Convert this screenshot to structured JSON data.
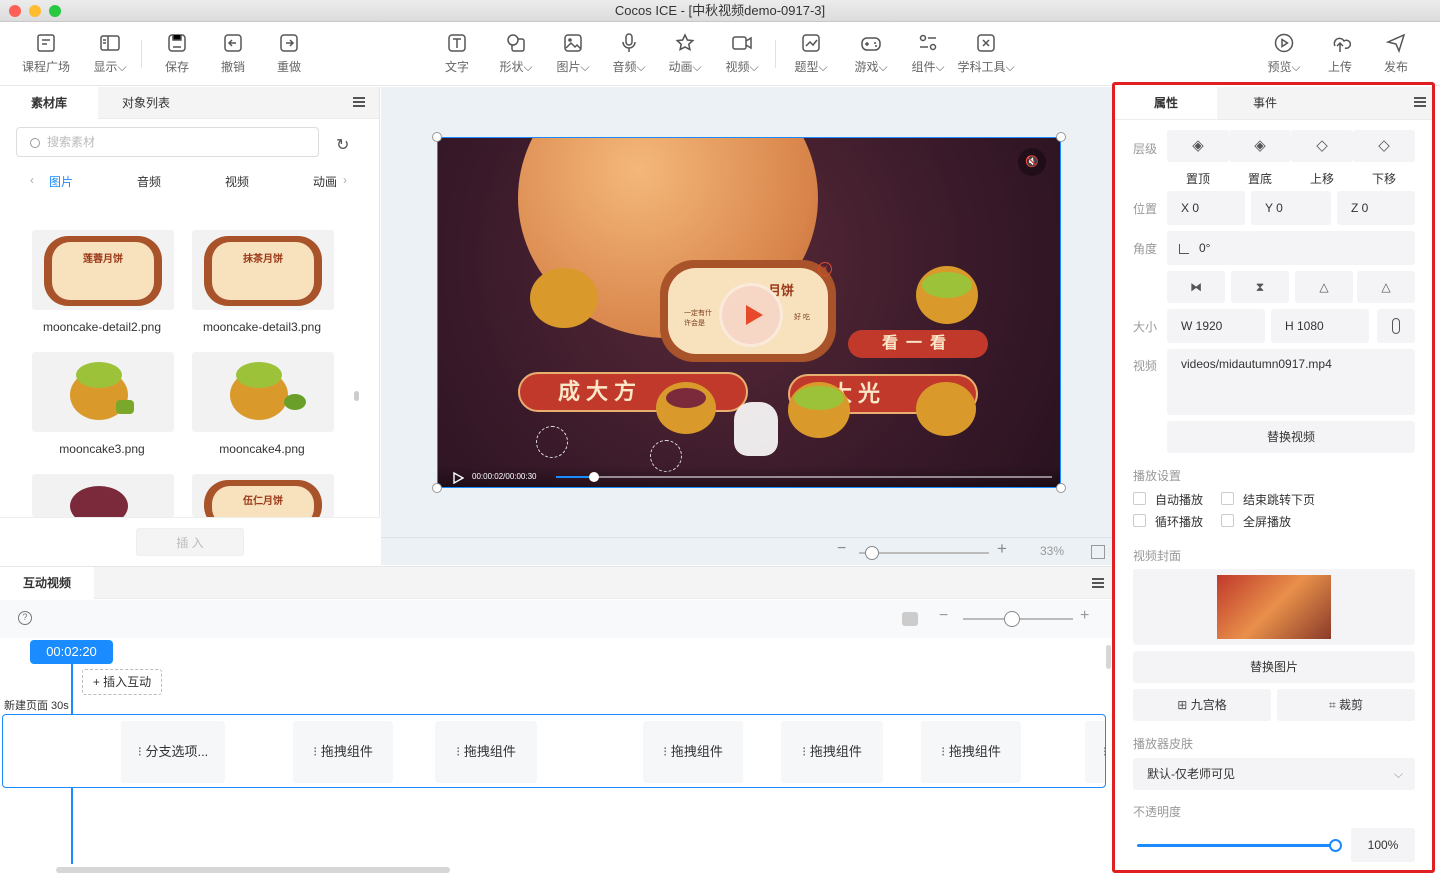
{
  "window": {
    "title": "Cocos ICE - [中秋视频demo-0917-3]"
  },
  "toolbar": {
    "left": [
      {
        "label": "课程广场",
        "icon": "course-square-icon"
      },
      {
        "label": "显示",
        "icon": "display-icon"
      },
      {
        "label": "保存",
        "icon": "save-icon"
      },
      {
        "label": "撤销",
        "icon": "undo-icon"
      },
      {
        "label": "重做",
        "icon": "redo-icon"
      }
    ],
    "center": [
      {
        "label": "文字",
        "icon": "text-icon"
      },
      {
        "label": "形状",
        "icon": "shape-icon"
      },
      {
        "label": "图片",
        "icon": "image-icon"
      },
      {
        "label": "音频",
        "icon": "audio-icon"
      },
      {
        "label": "动画",
        "icon": "animation-icon"
      },
      {
        "label": "视频",
        "icon": "video-icon"
      },
      {
        "label": "题型",
        "icon": "question-type-icon"
      },
      {
        "label": "游戏",
        "icon": "game-icon"
      },
      {
        "label": "组件",
        "icon": "component-icon"
      },
      {
        "label": "学科工具",
        "icon": "subject-tools-icon"
      }
    ],
    "right": [
      {
        "label": "预览",
        "icon": "preview-icon"
      },
      {
        "label": "上传",
        "icon": "upload-icon"
      },
      {
        "label": "发布",
        "icon": "publish-icon"
      }
    ]
  },
  "library": {
    "tabs": [
      "素材库",
      "对象列表"
    ],
    "search_placeholder": "搜索素材",
    "categories": [
      "图片",
      "音频",
      "视频",
      "动画"
    ],
    "assets": [
      "mooncake-detail2.png",
      "mooncake-detail3.png",
      "mooncake3.png",
      "mooncake4.png"
    ],
    "thumb_text": [
      "莲蓉月饼",
      "抹茶月饼",
      "伍仁月饼"
    ],
    "insert_label": "插 入"
  },
  "canvas": {
    "time": "00:00:02/00:00:30",
    "banner_left": "成大方",
    "banner_right": "看一看",
    "banner_right2": "大光",
    "card_title": "月饼",
    "card_text_left": "一定有什",
    "card_text_left2": "许会是",
    "card_text_right": "好 吃",
    "zoom": "33%"
  },
  "props": {
    "tabs": [
      "属性",
      "事件"
    ],
    "layer_label": "层级",
    "layer_buttons": [
      "置顶",
      "置底",
      "上移",
      "下移"
    ],
    "position_label": "位置",
    "x": "X  0",
    "y": "Y  0",
    "z": "Z  0",
    "angle_label": "角度",
    "angle": "0°",
    "size_label": "大小",
    "w": "W  1920",
    "h": "H  1080",
    "video_label": "视频",
    "video_path": "videos/midautumn0917.mp4",
    "replace_video": "替换视频",
    "play_settings": "播放设置",
    "autoplay": "自动播放",
    "end_jump": "结束跳转下页",
    "loop": "循环播放",
    "fullscreen": "全屏播放",
    "cover_label": "视频封面",
    "replace_image": "替换图片",
    "nine_grid": "九宫格",
    "crop": "裁剪",
    "skin_label": "播放器皮肤",
    "skin_value": "默认-仅老师可见",
    "opacity_label": "不透明度",
    "opacity": "100%"
  },
  "timeline": {
    "title": "互动视频",
    "current_time": "00:02:20",
    "insert_interaction": "+ 插入互动",
    "page_label": "新建页面  30s",
    "chips": [
      "分支选项...",
      "拖拽组件",
      "拖拽组件",
      "拖拽组件",
      "拖拽组件",
      "拖拽组件"
    ]
  },
  "colors": {
    "accent": "#1a8cff",
    "highlight": "#e02020",
    "canvas_bg": "#ecf1f6"
  }
}
